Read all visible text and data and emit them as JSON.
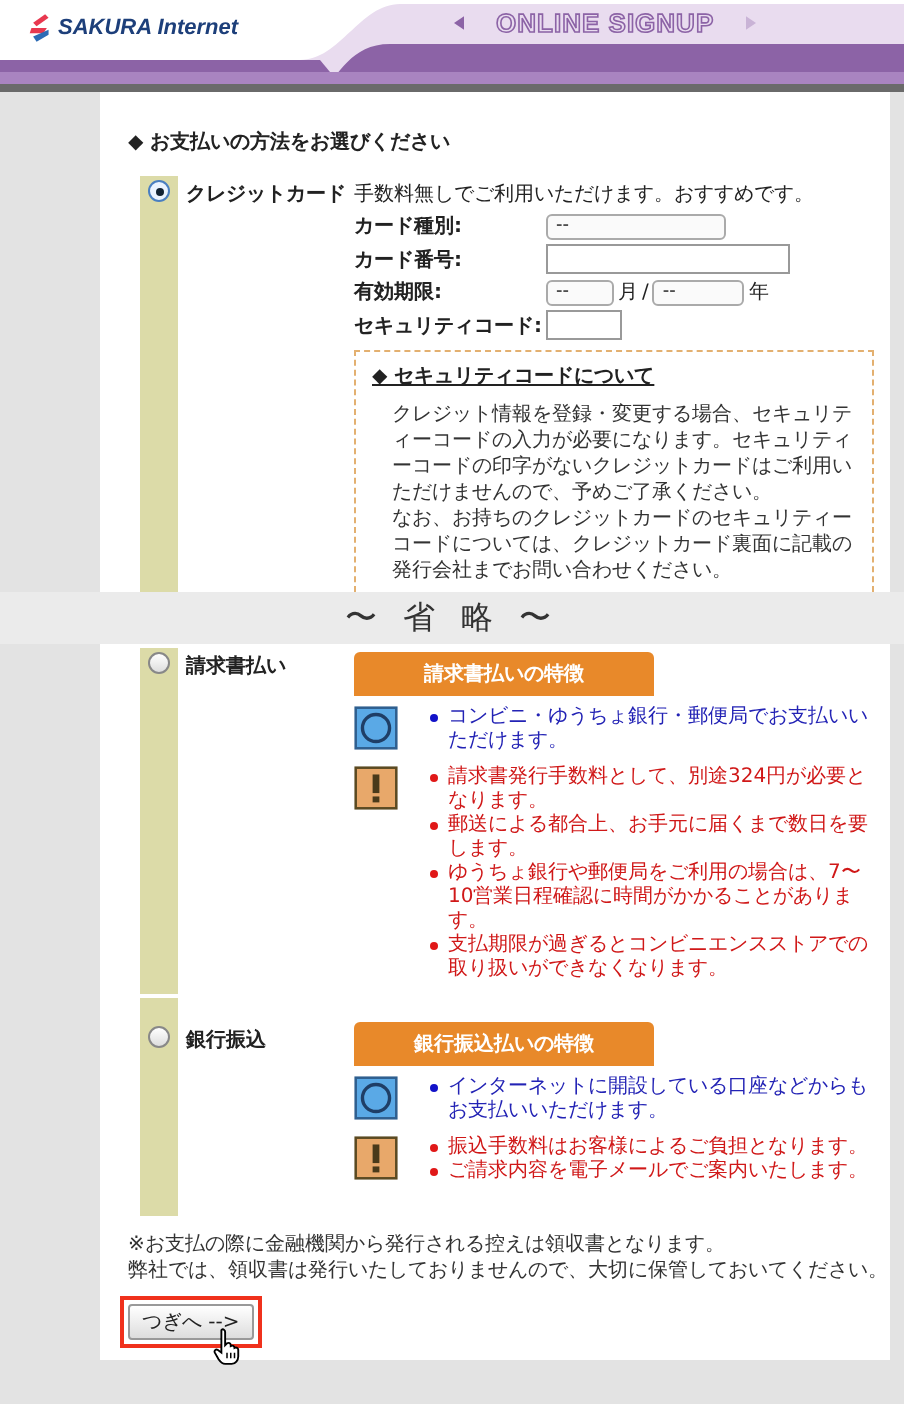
{
  "header": {
    "logo": "SAKURA Internet",
    "title": "ONLINE SIGNUP"
  },
  "heading": "◆ お支払いの方法をお選びください",
  "credit": {
    "label": "クレジットカード",
    "selected": true,
    "description": "手数料無しでご利用いただけます。おすすめです。",
    "fields": [
      {
        "kind": "select",
        "label": "カード種別:",
        "value": "--"
      },
      {
        "kind": "text",
        "label": "カード番号:"
      },
      {
        "kind": "expiry",
        "label": "有効期限:",
        "month": "--",
        "month_unit": "月",
        "separator": "/",
        "year": "--",
        "year_unit": "年"
      },
      {
        "kind": "short",
        "label": "セキュリティコード:"
      }
    ],
    "note": {
      "title": "◆ セキュリティコードについて",
      "body": [
        "クレジット情報を登録・変更する場合、セキュリティーコードの入力が必要になります。セキュリティーコードの印字がないクレジットカードはご利用いただけませんので、予めご了承ください。",
        "なお、お持ちのクレジットカードのセキュリティーコードについては、クレジットカード裏面に記載の発行会社までお問い合わせください。"
      ]
    }
  },
  "omission": "〜 省 略 〜",
  "methods": [
    {
      "label": "請求書払い",
      "selected": false,
      "banner": "請求書払いの特徴",
      "merits": [
        "コンビニ・ゆうちょ銀行・郵便局でお支払いいただけます。"
      ],
      "cautions": [
        "請求書発行手数料として、別途324円が必要となります。",
        "郵送による都合上、お手元に届くまで数日を要します。",
        "ゆうちょ銀行や郵便局をご利用の場合は、7〜10営業日程確認に時間がかかることがあります。",
        "支払期限が過ぎるとコンビニエンスストアでの取り扱いができなくなります。"
      ]
    },
    {
      "label": "銀行振込",
      "selected": false,
      "banner": "銀行振込払いの特徴",
      "merits": [
        "インターネットに開設している口座などからもお支払いいただけます。"
      ],
      "cautions": [
        "振込手数料はお客様によるご負担となります。",
        "ご請求内容を電子メールでご案内いたします。"
      ]
    }
  ],
  "footnote": [
    "※お支払の際に金融機関から発行される控えは領収書となります。",
    "弊社では、領収書は発行いたしておりませんので、大切に保管しておいてください。"
  ],
  "next_button": {
    "label": "つぎへ -->",
    "highlighted": true
  }
}
